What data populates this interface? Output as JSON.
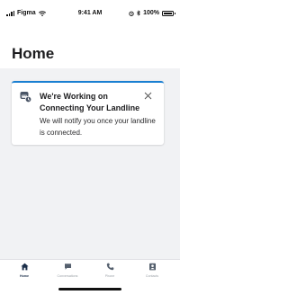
{
  "status_bar": {
    "carrier": "Figma",
    "time": "9:41 AM",
    "battery": "100%",
    "battery_level": 1.0
  },
  "header": {
    "title": "Home"
  },
  "notice": {
    "icon": "phone-in-progress-icon",
    "title": "We're Working on Connecting Your Landline",
    "body": "We will notify you once your landline is connected.",
    "close_icon": "close-icon",
    "accent_color": "#1a7fd1"
  },
  "tab_bar": {
    "tabs": [
      {
        "label": "Home",
        "icon": "home-icon",
        "active": true
      },
      {
        "label": "Conversations",
        "icon": "chat-bubble-icon",
        "active": false
      },
      {
        "label": "Phone",
        "icon": "phone-icon",
        "active": false
      },
      {
        "label": "Contacts",
        "icon": "contact-card-icon",
        "active": false
      }
    ]
  },
  "colors": {
    "content_background": "#f1f2f4",
    "tab_active": "#1c2f4a",
    "tab_inactive": "#9aa0a6"
  }
}
